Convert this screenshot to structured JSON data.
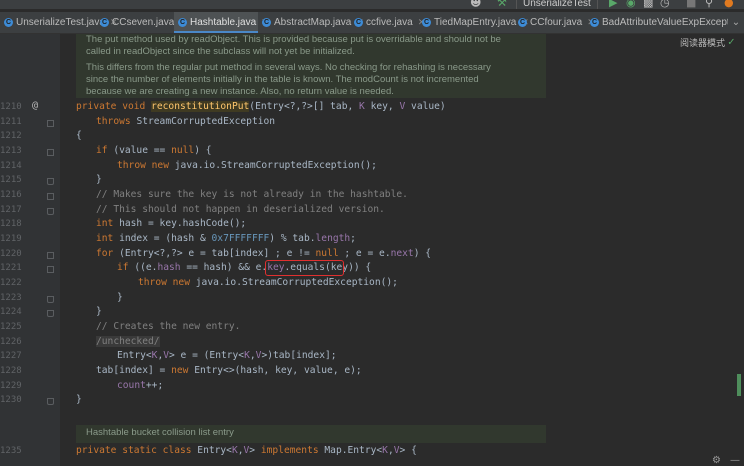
{
  "toolbar": {
    "run_config": "UnserializeTest",
    "icons": [
      "user-icon",
      "build-icon",
      "run-icon",
      "debug-icon",
      "coverage-icon",
      "profile-icon",
      "stop-icon",
      "search-icon",
      "update-icon"
    ]
  },
  "tabs": [
    {
      "label": "UnserializeTest.java",
      "active": false
    },
    {
      "label": "CCseven.java",
      "active": false
    },
    {
      "label": "Hashtable.java",
      "active": true
    },
    {
      "label": "AbstractMap.java",
      "active": false
    },
    {
      "label": "ccfive.java",
      "active": false
    },
    {
      "label": "TiedMapEntry.java",
      "active": false
    },
    {
      "label": "CCfour.java",
      "active": false
    },
    {
      "label": "BadAttributeValueExpException.java",
      "active": false
    }
  ],
  "editor": {
    "reader_mode_label": "阅读器模式",
    "doc_top": [
      "The put method used by readObject. This is provided because put is overridable and should not be",
      "called in readObject since the subclass will not yet be initialized.",
      "This differs from the regular put method in several ways. No checking for rehashing is necessary",
      "since the number of elements initially in the table is known. The modCount is not incremented",
      "because we are creating a new instance. Also, no return value is needed."
    ],
    "line_numbers": [
      "1210",
      "1211",
      "1212",
      "1213",
      "1214",
      "1215",
      "1216",
      "1217",
      "1218",
      "1219",
      "1220",
      "1221",
      "1222",
      "1223",
      "1224",
      "1225",
      "1226",
      "1227",
      "1228",
      "1229",
      "1230",
      "1235"
    ],
    "doc_bottom": "Hashtable bucket collision list entry",
    "code": {
      "l1210_a": "private void ",
      "l1210_fn": "reconstitutionPut",
      "l1210_b": "(Entry<?,?>[] tab, ",
      "l1210_k": "K",
      "l1210_c": " key, ",
      "l1210_v": "V",
      "l1210_d": " value)",
      "l1211_kw": "throws ",
      "l1211_b": "StreamCorruptedException",
      "l1212": "{",
      "l1213_a": "if ",
      "l1213_b": "(value == ",
      "l1213_c": "null",
      "l1213_d": ") {",
      "l1214_a": "throw new ",
      "l1214_b": "java.io.StreamCorruptedException();",
      "l1215": "}",
      "l1216": "// Makes sure the key is not already in the hashtable.",
      "l1217": "// This should not happen in deserialized version.",
      "l1218_a": "int ",
      "l1218_b": "hash = key.hashCode();",
      "l1219_a": "int ",
      "l1219_b": "index = (hash & ",
      "l1219_c": "0x7FFFFFFF",
      "l1219_d": ") % tab.",
      "l1219_e": "length",
      "l1219_f": ";",
      "l1220_a": "for ",
      "l1220_b": "(Entry<?,?> e = tab[index] ; e != ",
      "l1220_c": "null",
      "l1220_d": " ; e = e.",
      "l1220_e": "next",
      "l1220_f": ") {",
      "l1221_a": "if ",
      "l1221_b": "((e.",
      "l1221_c": "hash",
      "l1221_d": " == hash) && ",
      "l1221_e": "e.",
      "l1221_f": "key",
      "l1221_g": ".equals(key)) {",
      "l1222_a": "throw new ",
      "l1222_b": "java.io.StreamCorruptedException();",
      "l1223": "}",
      "l1224": "}",
      "l1225": "// Creates the new entry.",
      "l1226": "/unchecked/",
      "l1227_a": "Entry<",
      "l1227_k": "K",
      "l1227_b": ",",
      "l1227_v": "V",
      "l1227_c": "> e = (Entry<",
      "l1227_k2": "K",
      "l1227_d": ",",
      "l1227_v2": "V",
      "l1227_e": ">)tab[index];",
      "l1228_a": "tab[index] = ",
      "l1228_b": "new ",
      "l1228_c": "Entry<>(hash, key, value, e);",
      "l1229_a": "count",
      "l1229_b": "++;",
      "l1230": "}",
      "l1235_a": "private static class ",
      "l1235_b": "Entry<",
      "l1235_k": "K",
      "l1235_c": ",",
      "l1235_v": "V",
      "l1235_d": "> ",
      "l1235_e": "implements ",
      "l1235_f": "Map.Entry<",
      "l1235_k2": "K",
      "l1235_g": ",",
      "l1235_v2": "V",
      "l1235_h": "> {"
    }
  },
  "colors": {
    "background": "#2b2b2b",
    "keyword": "#cc7832",
    "method_decl": "#ffc66d",
    "type_param": "#9876aa",
    "number": "#6897bb",
    "comment": "#808080",
    "highlight_box": "#e03030"
  }
}
